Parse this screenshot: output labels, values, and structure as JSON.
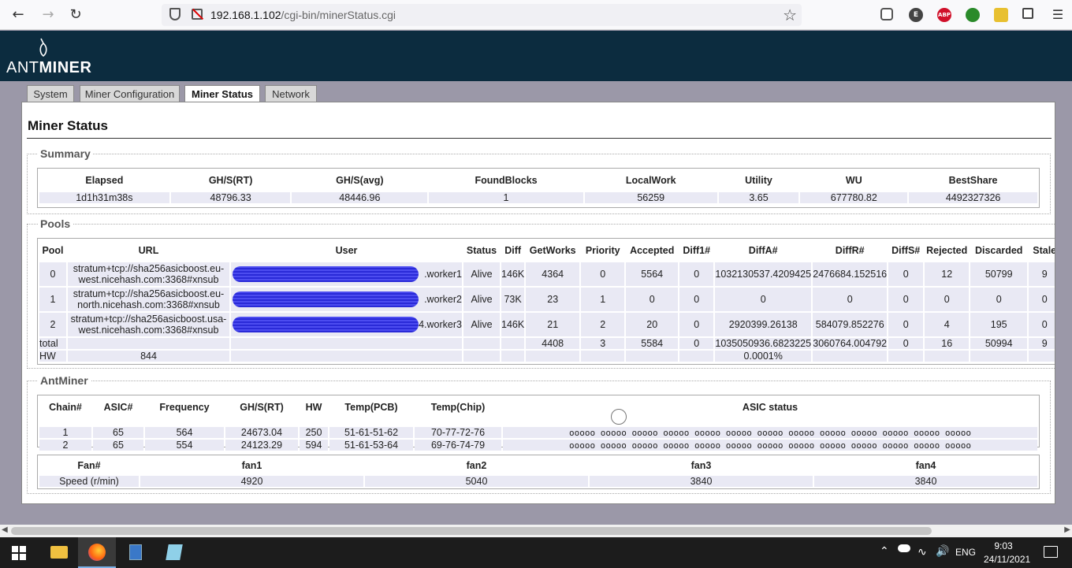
{
  "browser": {
    "url_host": "192.168.1.102",
    "url_path": "/cgi-bin/minerStatus.cgi"
  },
  "brand": {
    "ant": "ANT",
    "miner": "MINER"
  },
  "tabs": [
    {
      "label": "System"
    },
    {
      "label": "Miner Configuration"
    },
    {
      "label": "Miner Status"
    },
    {
      "label": "Network"
    }
  ],
  "page_title": "Miner Status",
  "summary": {
    "legend": "Summary",
    "headers": [
      "Elapsed",
      "GH/S(RT)",
      "GH/S(avg)",
      "FoundBlocks",
      "LocalWork",
      "Utility",
      "WU",
      "BestShare"
    ],
    "values": [
      "1d1h31m38s",
      "48796.33",
      "48446.96",
      "1",
      "56259",
      "3.65",
      "677780.82",
      "4492327326"
    ]
  },
  "pools": {
    "legend": "Pools",
    "headers": [
      "Pool",
      "URL",
      "User",
      "Status",
      "Diff",
      "GetWorks",
      "Priority",
      "Accepted",
      "Diff1#",
      "DiffA#",
      "DiffR#",
      "DiffS#",
      "Rejected",
      "Discarded",
      "Stale"
    ],
    "rows": [
      {
        "pool": "0",
        "url1": "stratum+tcp://sha256asicboost.eu-",
        "url2": "west.nicehash.com:3368#xnsub",
        "user": ".worker1",
        "status": "Alive",
        "diff": "146K",
        "getworks": "4364",
        "priority": "0",
        "accepted": "5564",
        "diff1": "0",
        "diffa": "1032130537.4209425",
        "diffr": "2476684.152516",
        "diffs": "0",
        "rejected": "12",
        "discarded": "50799",
        "stale": "9"
      },
      {
        "pool": "1",
        "url1": "stratum+tcp://sha256asicboost.eu-",
        "url2": "north.nicehash.com:3368#xnsub",
        "user": ".worker2",
        "status": "Alive",
        "diff": "73K",
        "getworks": "23",
        "priority": "1",
        "accepted": "0",
        "diff1": "0",
        "diffa": "0",
        "diffr": "0",
        "diffs": "0",
        "rejected": "0",
        "discarded": "0",
        "stale": "0"
      },
      {
        "pool": "2",
        "url1": "stratum+tcp://sha256asicboost.usa-",
        "url2": "west.nicehash.com:3368#xnsub",
        "user": "4.worker3",
        "status": "Alive",
        "diff": "146K",
        "getworks": "21",
        "priority": "2",
        "accepted": "20",
        "diff1": "0",
        "diffa": "2920399.26138",
        "diffr": "584079.852276",
        "diffs": "0",
        "rejected": "4",
        "discarded": "195",
        "stale": "0"
      }
    ],
    "total": {
      "label": "total",
      "getworks": "4408",
      "priority": "3",
      "accepted": "5584",
      "diff1": "0",
      "diffa": "1035050936.6823225",
      "diffr": "3060764.004792",
      "diffs": "0",
      "rejected": "16",
      "discarded": "50994",
      "stale": "9"
    },
    "hw": {
      "label": "HW",
      "value": "844",
      "pct": "0.0001%"
    }
  },
  "antminer": {
    "legend": "AntMiner",
    "headers": [
      "Chain#",
      "ASIC#",
      "Frequency",
      "GH/S(RT)",
      "HW",
      "Temp(PCB)",
      "Temp(Chip)",
      "ASIC status"
    ],
    "rows": [
      [
        "1",
        "65",
        "564",
        "24673.04",
        "250",
        "51-61-51-62",
        "70-77-72-76",
        "ooooo ooooo ooooo ooooo ooooo ooooo ooooo ooooo ooooo ooooo ooooo ooooo ooooo"
      ],
      [
        "2",
        "65",
        "554",
        "24123.29",
        "594",
        "51-61-53-64",
        "69-76-74-79",
        "ooooo ooooo ooooo ooooo ooooo ooooo ooooo ooooo ooooo ooooo ooooo ooooo ooooo"
      ]
    ],
    "fans": {
      "headers": [
        "Fan#",
        "fan1",
        "fan2",
        "fan3",
        "fan4"
      ],
      "label": "Speed (r/min)",
      "values": [
        "4920",
        "5040",
        "3840",
        "3840"
      ]
    }
  },
  "taskbar": {
    "lang": "ENG",
    "time": "9:03",
    "date": "24/11/2021"
  }
}
